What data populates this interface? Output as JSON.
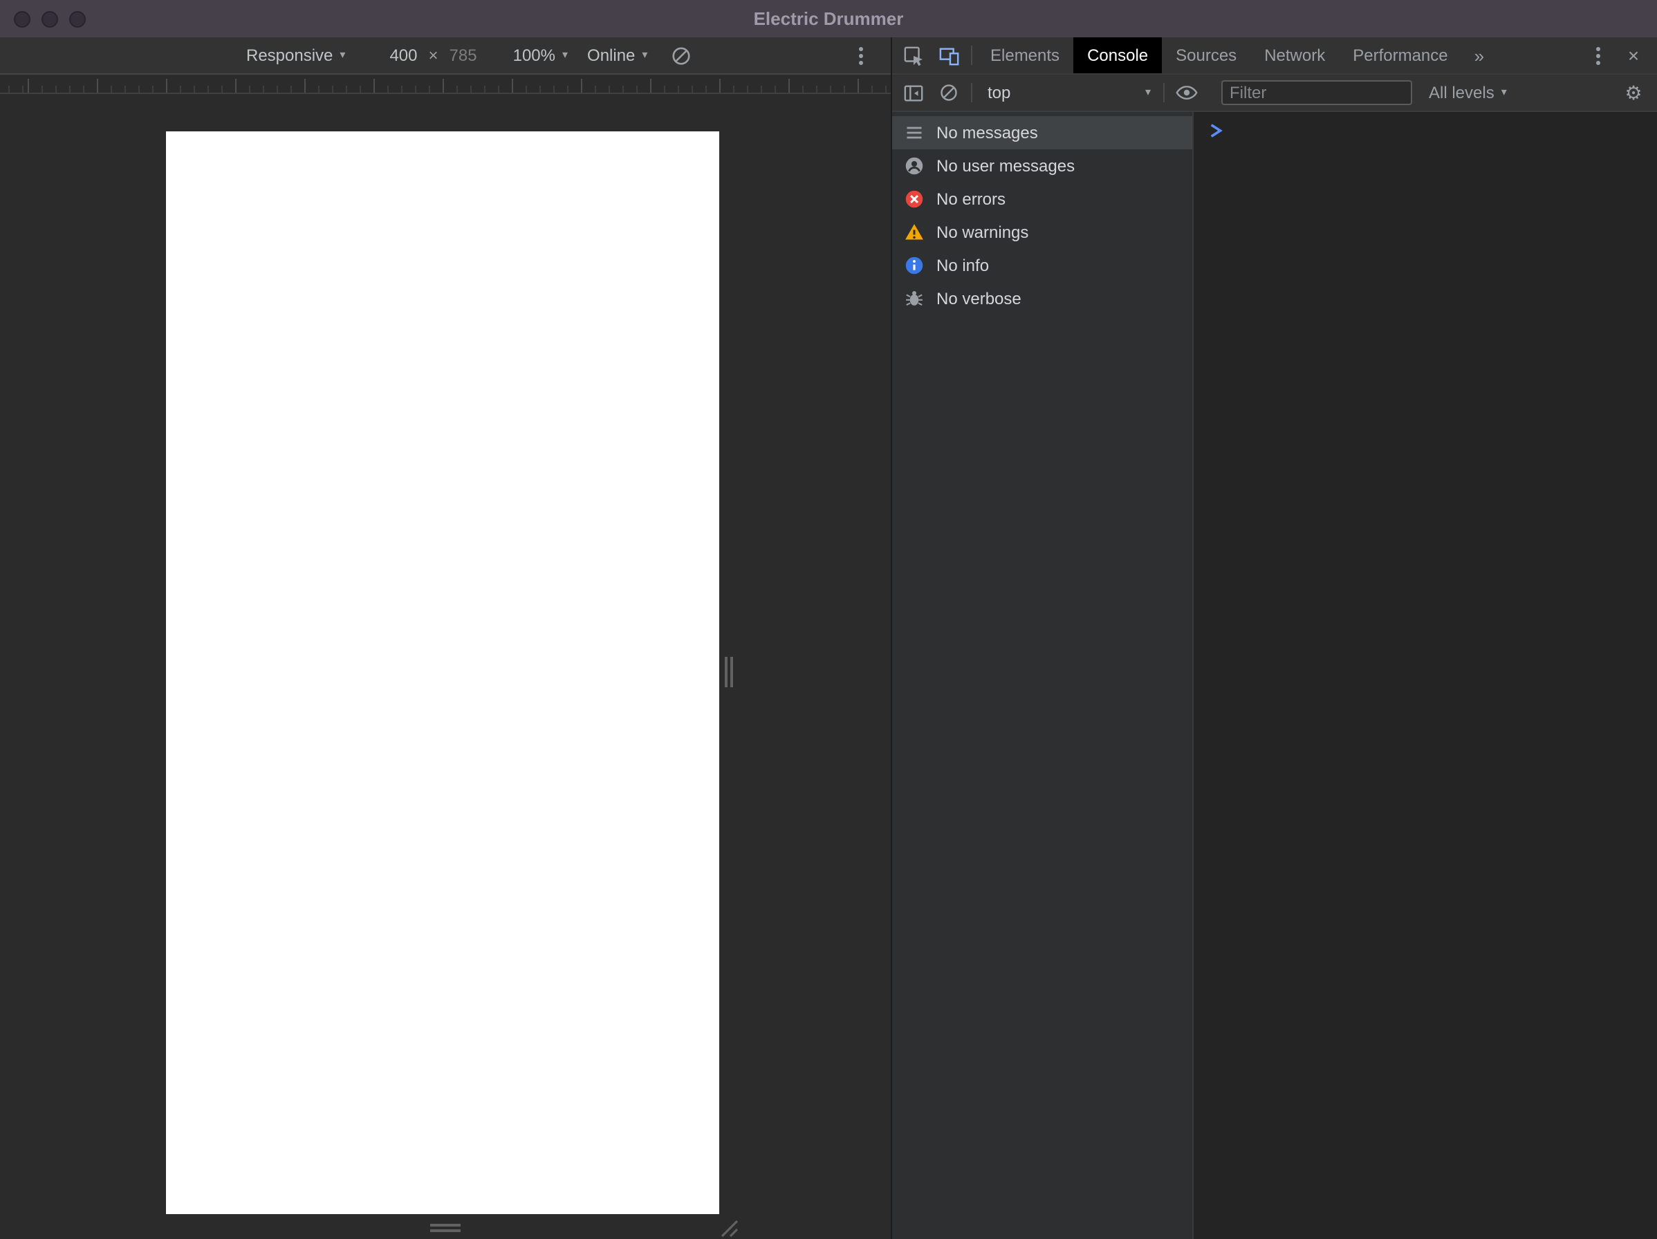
{
  "window": {
    "title": "Electric Drummer"
  },
  "device_toolbar": {
    "mode": "Responsive",
    "width": "400",
    "times": "×",
    "height": "785",
    "zoom": "100%",
    "network": "Online"
  },
  "devtools": {
    "tabs": [
      "Elements",
      "Console",
      "Sources",
      "Network",
      "Performance"
    ],
    "active_tab": "Console",
    "overflow": "»",
    "console_toolbar": {
      "context": "top",
      "filter_placeholder": "Filter",
      "levels": "All levels"
    },
    "sidebar": {
      "selected": "No messages",
      "items": [
        {
          "label": "No messages",
          "icon": "list-icon"
        },
        {
          "label": "No user messages",
          "icon": "user-icon"
        },
        {
          "label": "No errors",
          "icon": "error-icon"
        },
        {
          "label": "No warnings",
          "icon": "warning-icon"
        },
        {
          "label": "No info",
          "icon": "info-icon"
        },
        {
          "label": "No verbose",
          "icon": "bug-icon"
        }
      ]
    }
  },
  "icons": {
    "dropdown": "▾",
    "close": "×",
    "gear": "⚙"
  },
  "colors": {
    "titlebar": "#454049",
    "error_red": "#e8453c",
    "warning_yellow": "#f2a600",
    "info_blue": "#3b78e7",
    "accent_blue": "#8ab4f8",
    "prompt_blue": "#5b8df8"
  }
}
